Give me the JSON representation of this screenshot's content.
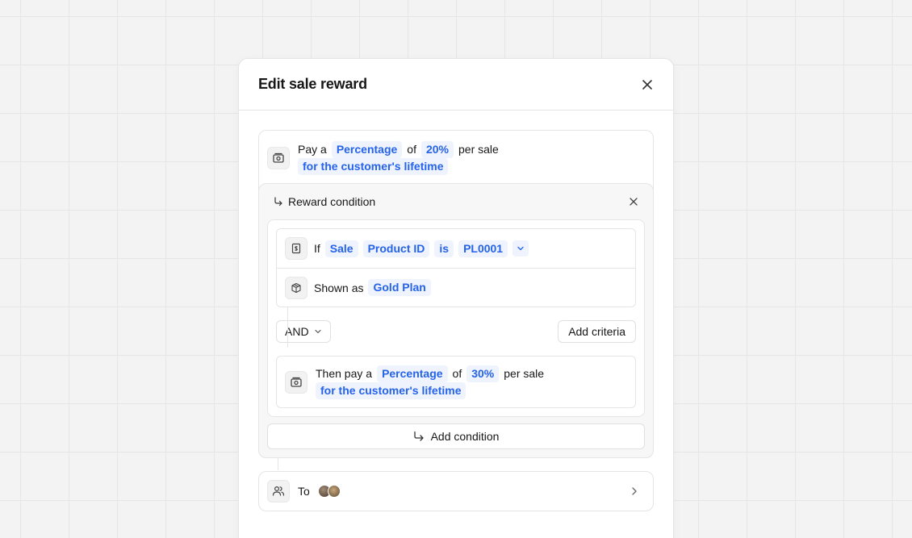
{
  "modal": {
    "title": "Edit sale reward"
  },
  "reward": {
    "prefix": "Pay a",
    "type": "Percentage",
    "of": "of",
    "amount": "20%",
    "suffix": "per sale",
    "duration": "for the customer's lifetime"
  },
  "condition": {
    "header": "Reward condition",
    "criteria": {
      "if": "If",
      "entity": "Sale",
      "attribute": "Product ID",
      "operator": "is",
      "value": "PL0001"
    },
    "shown_as": {
      "label": "Shown as",
      "value": "Gold Plan"
    },
    "logic_operator": "AND",
    "add_criteria": "Add criteria",
    "then": {
      "prefix": "Then pay a",
      "type": "Percentage",
      "of": "of",
      "amount": "30%",
      "suffix": "per sale",
      "duration": "for the customer's lifetime"
    }
  },
  "add_condition": "Add condition",
  "to": {
    "label": "To"
  },
  "colors": {
    "accent": "#2563eb",
    "pill_bg": "#eef3fd"
  },
  "icons": [
    "close-icon",
    "money-icon",
    "arrow-turn-icon",
    "receipt-icon",
    "box-icon",
    "chevron-down-icon",
    "users-icon",
    "chevron-right-icon"
  ]
}
